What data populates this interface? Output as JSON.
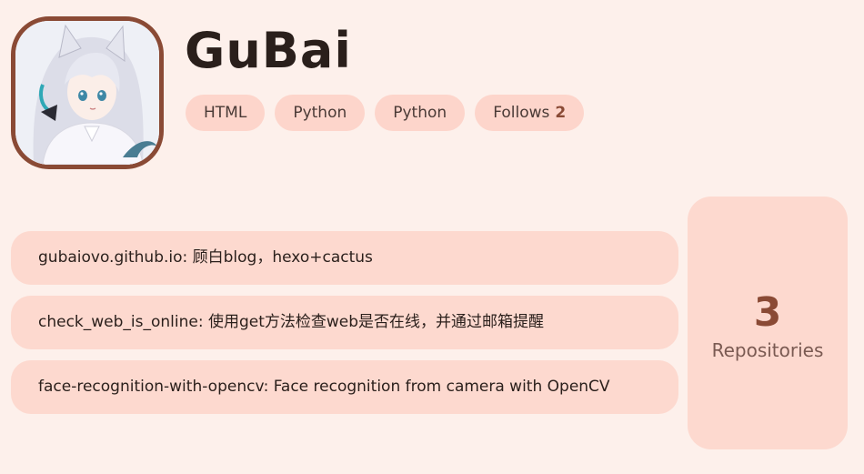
{
  "profile": {
    "name": "GuBai",
    "avatar_icon": "anime-avatar-icon"
  },
  "tags": [
    {
      "label": "HTML"
    },
    {
      "label": "Python"
    },
    {
      "label": "Python"
    },
    {
      "label": "Follows",
      "count": "2"
    }
  ],
  "repos": [
    {
      "text": "gubaiovo.github.io: 顾白blog，hexo+cactus"
    },
    {
      "text": "check_web_is_online: 使用get方法检查web是否在线，并通过邮箱提醒"
    },
    {
      "text": "face-recognition-with-opencv: Face recognition from camera with OpenCV"
    }
  ],
  "stats": {
    "repositories_count": "3",
    "repositories_label": "Repositories"
  },
  "colors": {
    "background": "#fdf0eb",
    "pill": "#fdd9cf",
    "accent": "#8a4a35"
  }
}
